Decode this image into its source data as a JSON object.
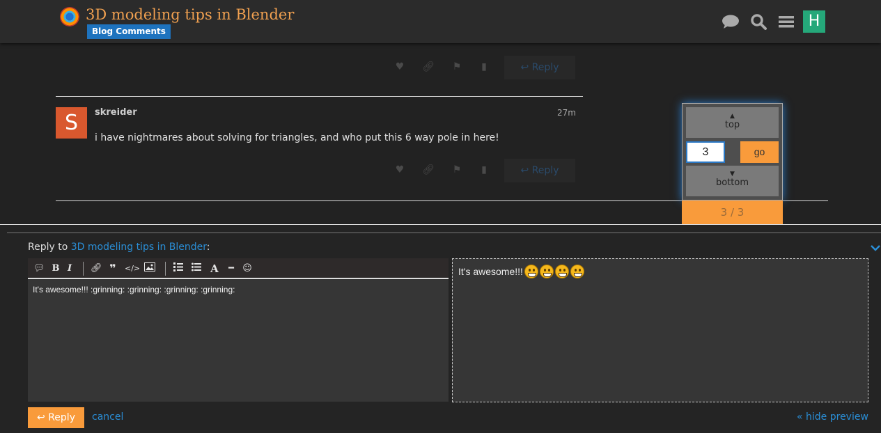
{
  "header": {
    "title": "3D modeling tips in Blender",
    "category": "Blog Comments",
    "user_initial": "H",
    "icons": [
      "chat-bubble-icon",
      "search-icon",
      "hamburger-menu-icon"
    ]
  },
  "posts": [
    {
      "actions": {
        "reply_label": "Reply"
      }
    },
    {
      "avatar_initial": "S",
      "username": "skreider",
      "time": "27m",
      "body": "i have nightmares about solving for triangles, and who put this 6 way pole in here!",
      "actions": {
        "reply_label": "Reply"
      }
    }
  ],
  "timeline": {
    "top_label": "top",
    "bottom_label": "bottom",
    "post_number": "3",
    "go_label": "go",
    "progress": "3 / 3"
  },
  "composer": {
    "reply_to_prefix": "Reply to",
    "topic_link": "3D modeling tips in Blender",
    "reply_to_suffix": ":",
    "editor_text": "It's awesome!!! :grinning: :grinning: :grinning: :grinning:",
    "preview_text": "It's awesome!!!",
    "reply_button": "Reply",
    "cancel": "cancel",
    "hide_preview": "« hide preview"
  },
  "colors": {
    "accent": "#f99b3b",
    "link": "#2a8ed6",
    "category": "#1e73be",
    "avatar_s": "#d9582e",
    "avatar_h": "#25a87a"
  }
}
